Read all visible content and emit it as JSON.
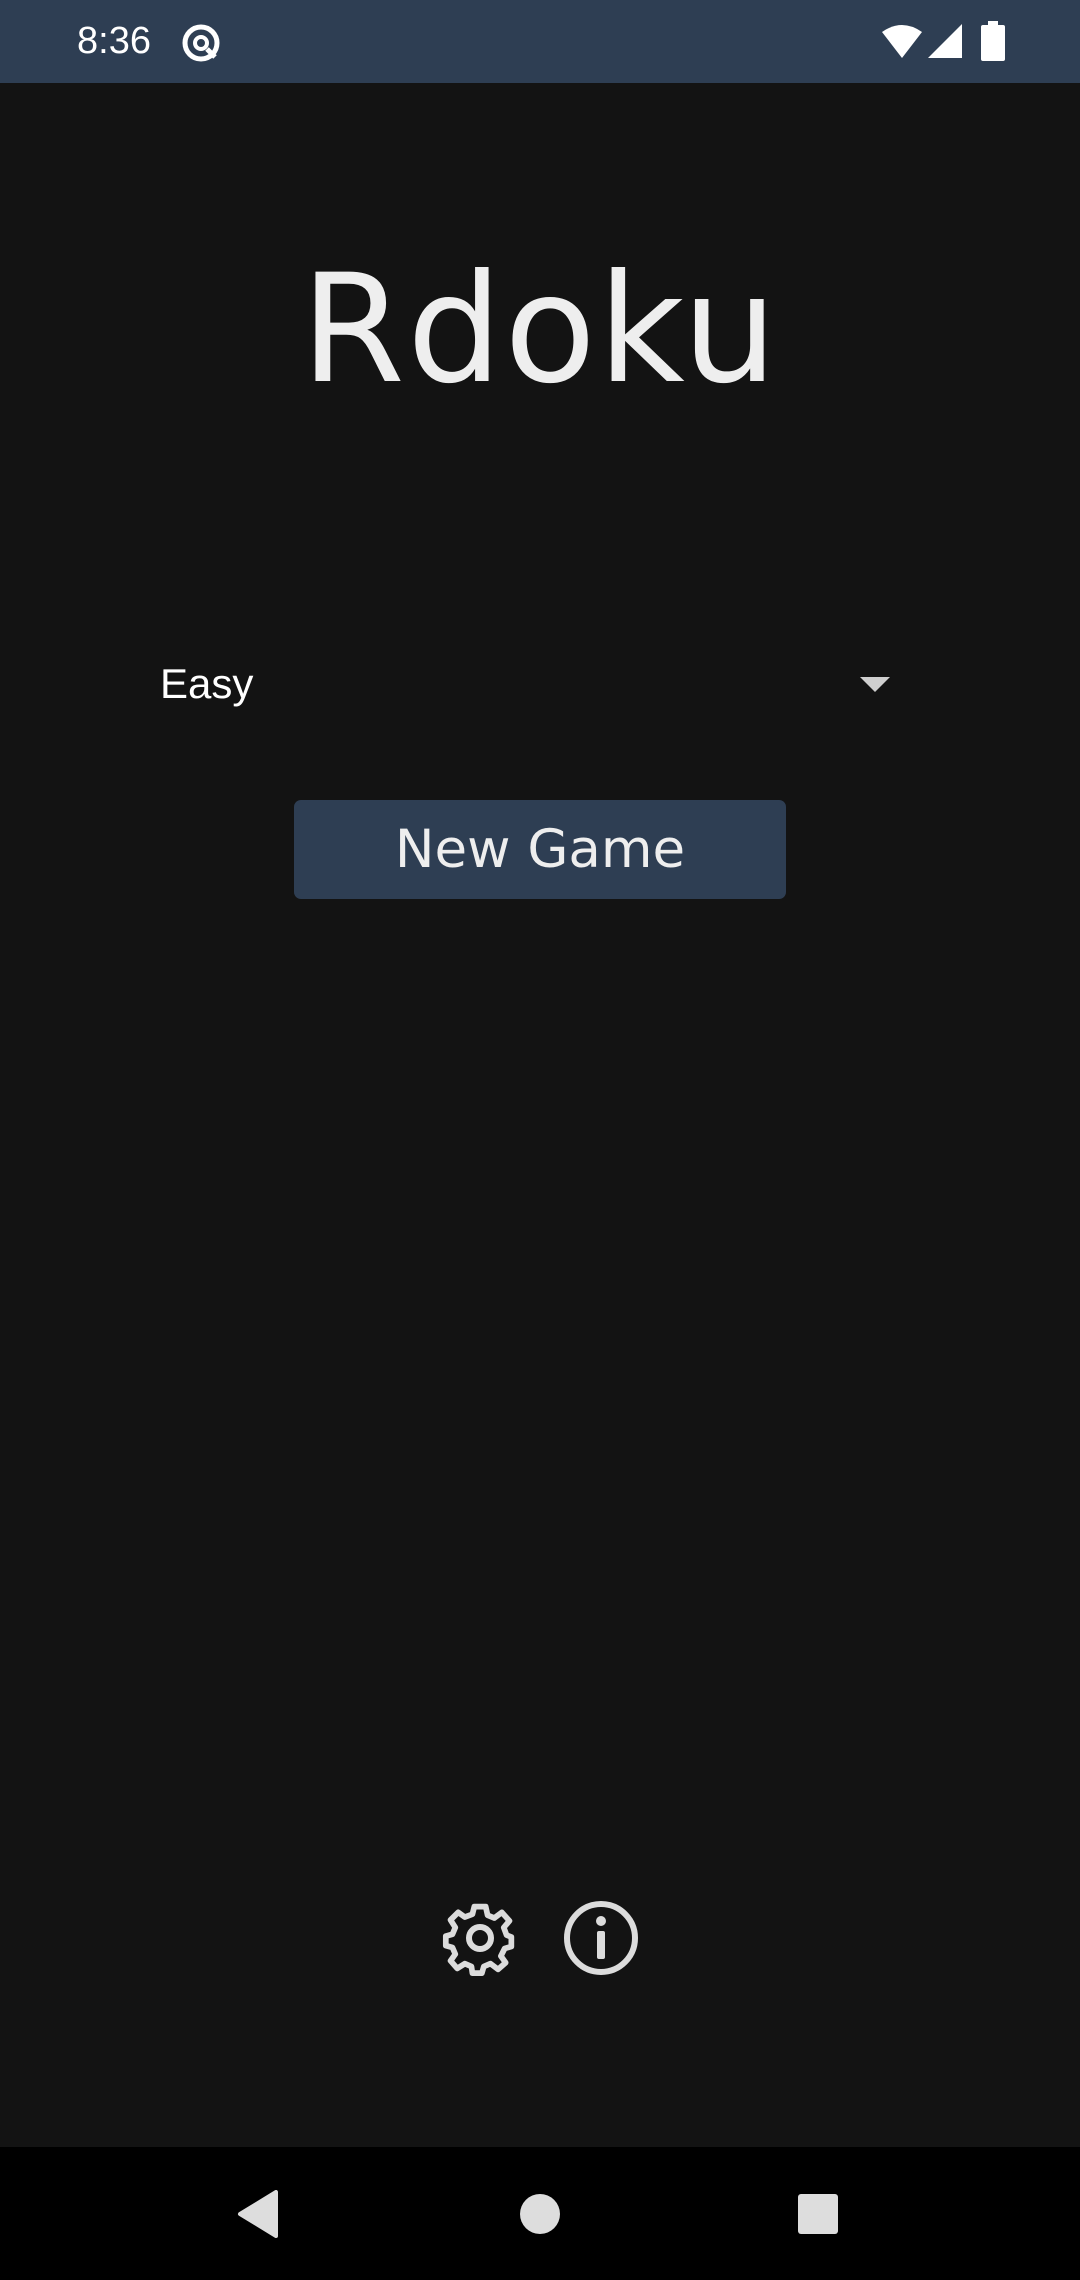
{
  "status_bar": {
    "time": "8:36",
    "app_icon": "at-sign-icon",
    "wifi_icon": "wifi-icon",
    "signal_icon": "cellular-signal-icon",
    "battery_icon": "battery-icon",
    "background": "#2e3e53"
  },
  "app": {
    "title": "Rdoku"
  },
  "difficulty": {
    "selected": "Easy",
    "icon": "chevron-down-icon"
  },
  "actions": {
    "new_game_label": "New Game",
    "button_color": "#2e3e53"
  },
  "bottom_icons": {
    "settings": "gear-icon",
    "info": "info-icon"
  },
  "nav_bar": {
    "back": "back-icon",
    "home": "home-icon",
    "recents": "recents-icon"
  }
}
